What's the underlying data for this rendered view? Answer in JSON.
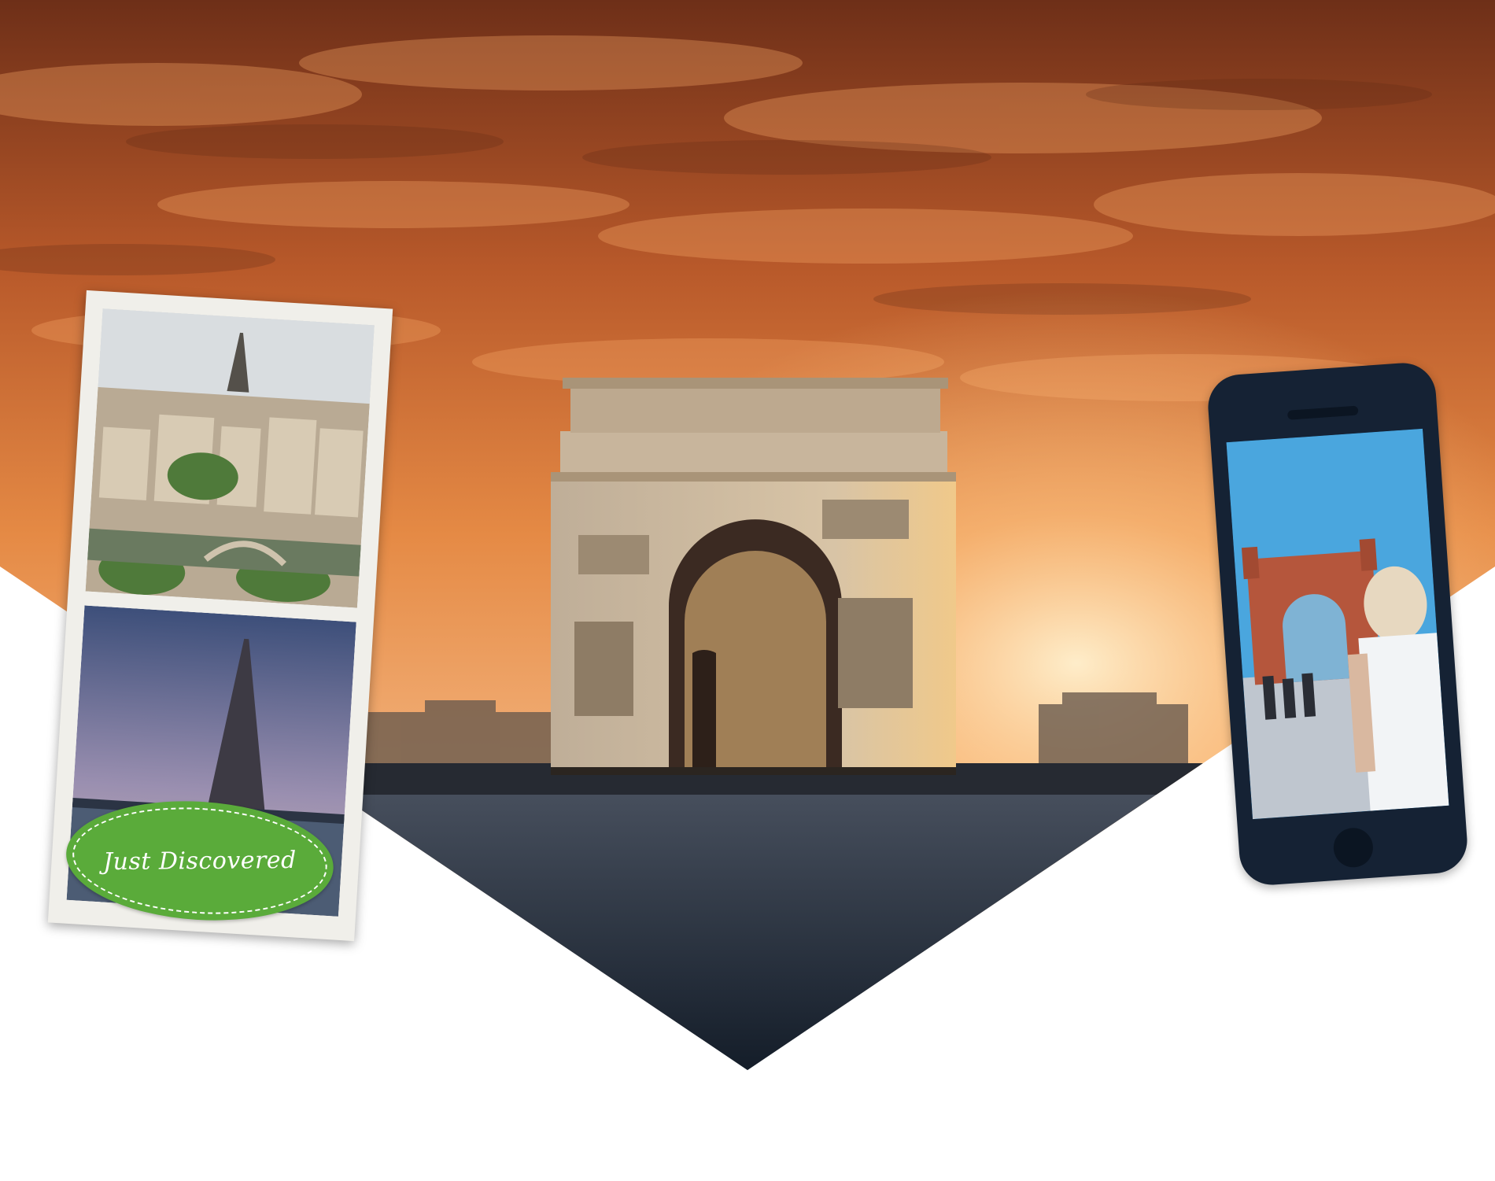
{
  "badge": {
    "text": "Just Discovered"
  },
  "colors": {
    "sky_top": "#8a3f1e",
    "sky_mid": "#e58a45",
    "sky_glow": "#ffd7a0",
    "ground": "#1f2a38",
    "badge_green": "#5aab3a",
    "phone_body": "#152234",
    "phone_sky": "#3b9ad8"
  }
}
